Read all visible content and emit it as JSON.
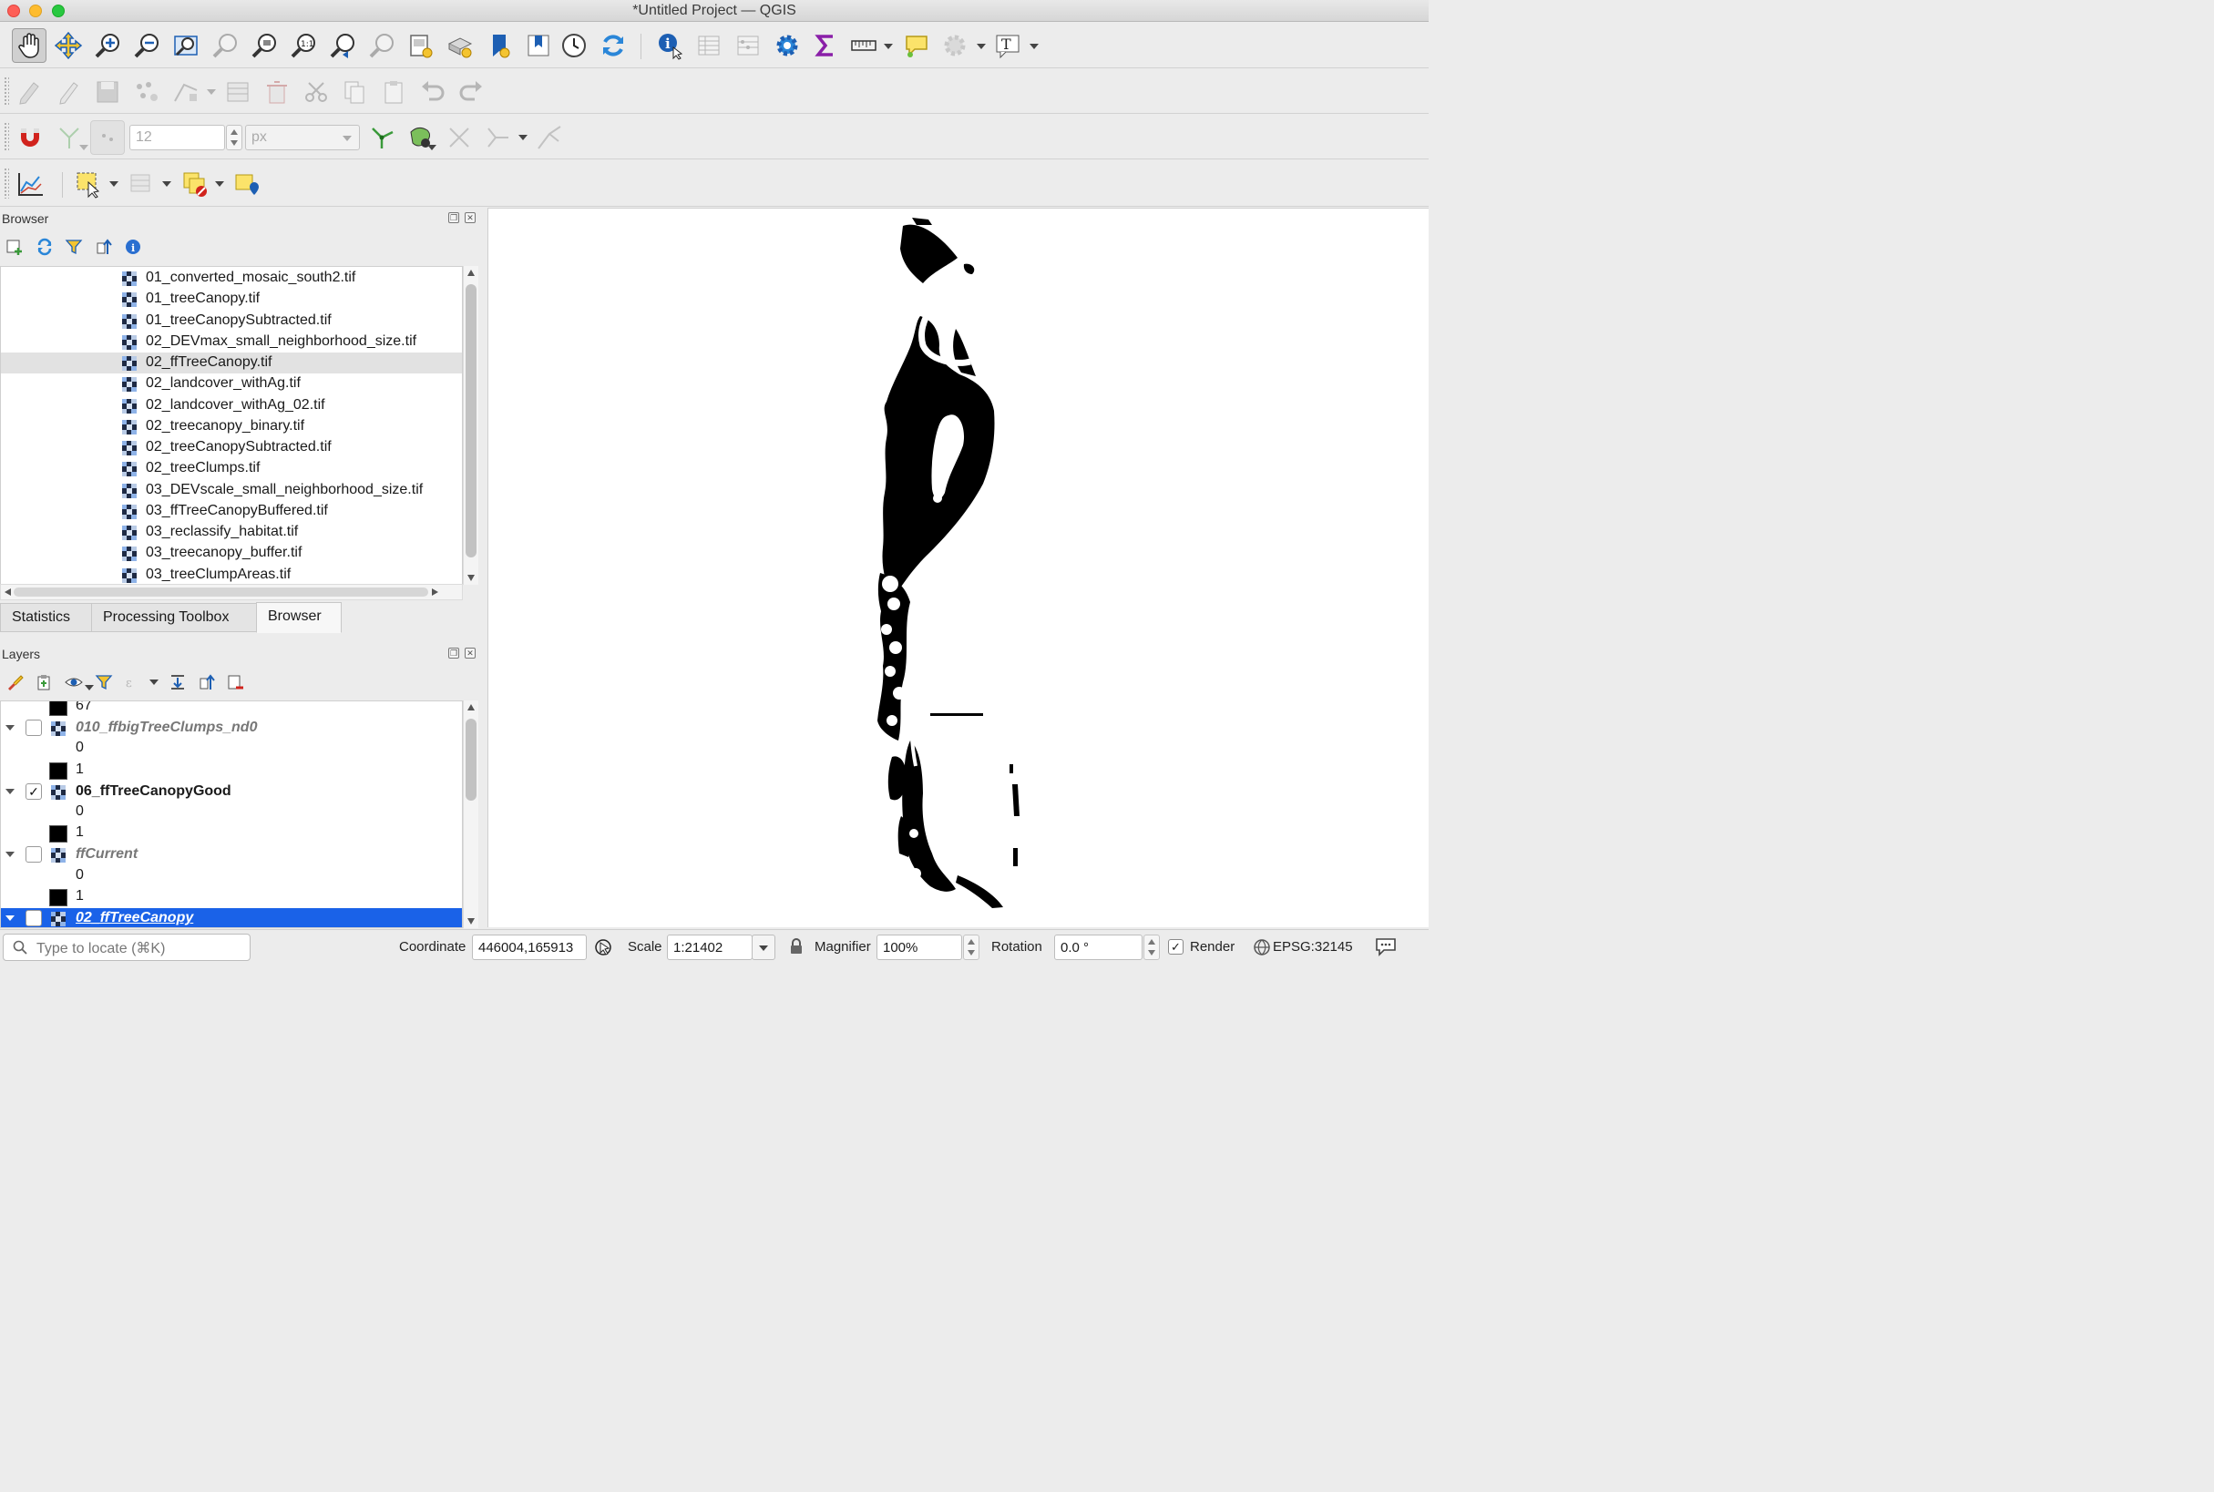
{
  "window": {
    "title": "*Untitled Project — QGIS"
  },
  "snapping": {
    "tolerance_value": "12",
    "unit": "px"
  },
  "browser": {
    "title": "Browser",
    "items": [
      {
        "label": "01_converted_mosaic_south2.tif"
      },
      {
        "label": "01_treeCanopy.tif"
      },
      {
        "label": "01_treeCanopySubtracted.tif"
      },
      {
        "label": "02_DEVmax_small_neighborhood_size.tif"
      },
      {
        "label": "02_ffTreeCanopy.tif",
        "selected": true
      },
      {
        "label": "02_landcover_withAg.tif"
      },
      {
        "label": "02_landcover_withAg_02.tif"
      },
      {
        "label": "02_treecanopy_binary.tif"
      },
      {
        "label": "02_treeCanopySubtracted.tif"
      },
      {
        "label": "02_treeClumps.tif"
      },
      {
        "label": "03_DEVscale_small_neighborhood_size.tif"
      },
      {
        "label": "03_ffTreeCanopyBuffered.tif"
      },
      {
        "label": "03_reclassify_habitat.tif"
      },
      {
        "label": "03_treecanopy_buffer.tif"
      },
      {
        "label": "03_treeClumpAreas.tif"
      }
    ]
  },
  "tabs": [
    {
      "label": "Statistics"
    },
    {
      "label": "Processing Toolbox"
    },
    {
      "label": "Browser",
      "active": true
    }
  ],
  "layers": {
    "title": "Layers",
    "rows": [
      {
        "kind": "legend",
        "value": "67",
        "swatch": "black"
      },
      {
        "kind": "layer",
        "label": "010_ffbigTreeClumps_nd0",
        "checked": false
      },
      {
        "kind": "legend",
        "value": "0",
        "swatch": "none"
      },
      {
        "kind": "legend",
        "value": "1",
        "swatch": "black"
      },
      {
        "kind": "layer",
        "label": "06_ffTreeCanopyGood",
        "checked": true
      },
      {
        "kind": "legend",
        "value": "0",
        "swatch": "none"
      },
      {
        "kind": "legend",
        "value": "1",
        "swatch": "black"
      },
      {
        "kind": "layer",
        "label": "ffCurrent",
        "checked": false
      },
      {
        "kind": "legend",
        "value": "0",
        "swatch": "none"
      },
      {
        "kind": "legend",
        "value": "1",
        "swatch": "black"
      },
      {
        "kind": "layer",
        "label": "02_ffTreeCanopy",
        "checked": false,
        "selected": true
      }
    ]
  },
  "status": {
    "locate_placeholder": "Type to locate (⌘K)",
    "coordinate_label": "Coordinate",
    "coordinate_value": "446004,165913",
    "scale_label": "Scale",
    "scale_value": "1:21402",
    "magnifier_label": "Magnifier",
    "magnifier_value": "100%",
    "rotation_label": "Rotation",
    "rotation_value": "0.0 °",
    "render_label": "Render",
    "render_checked": true,
    "crs": "EPSG:32145"
  },
  "colors": {
    "selection": "#1a62e8",
    "raster_fill": "#000000",
    "map_background": "#ffffff"
  }
}
